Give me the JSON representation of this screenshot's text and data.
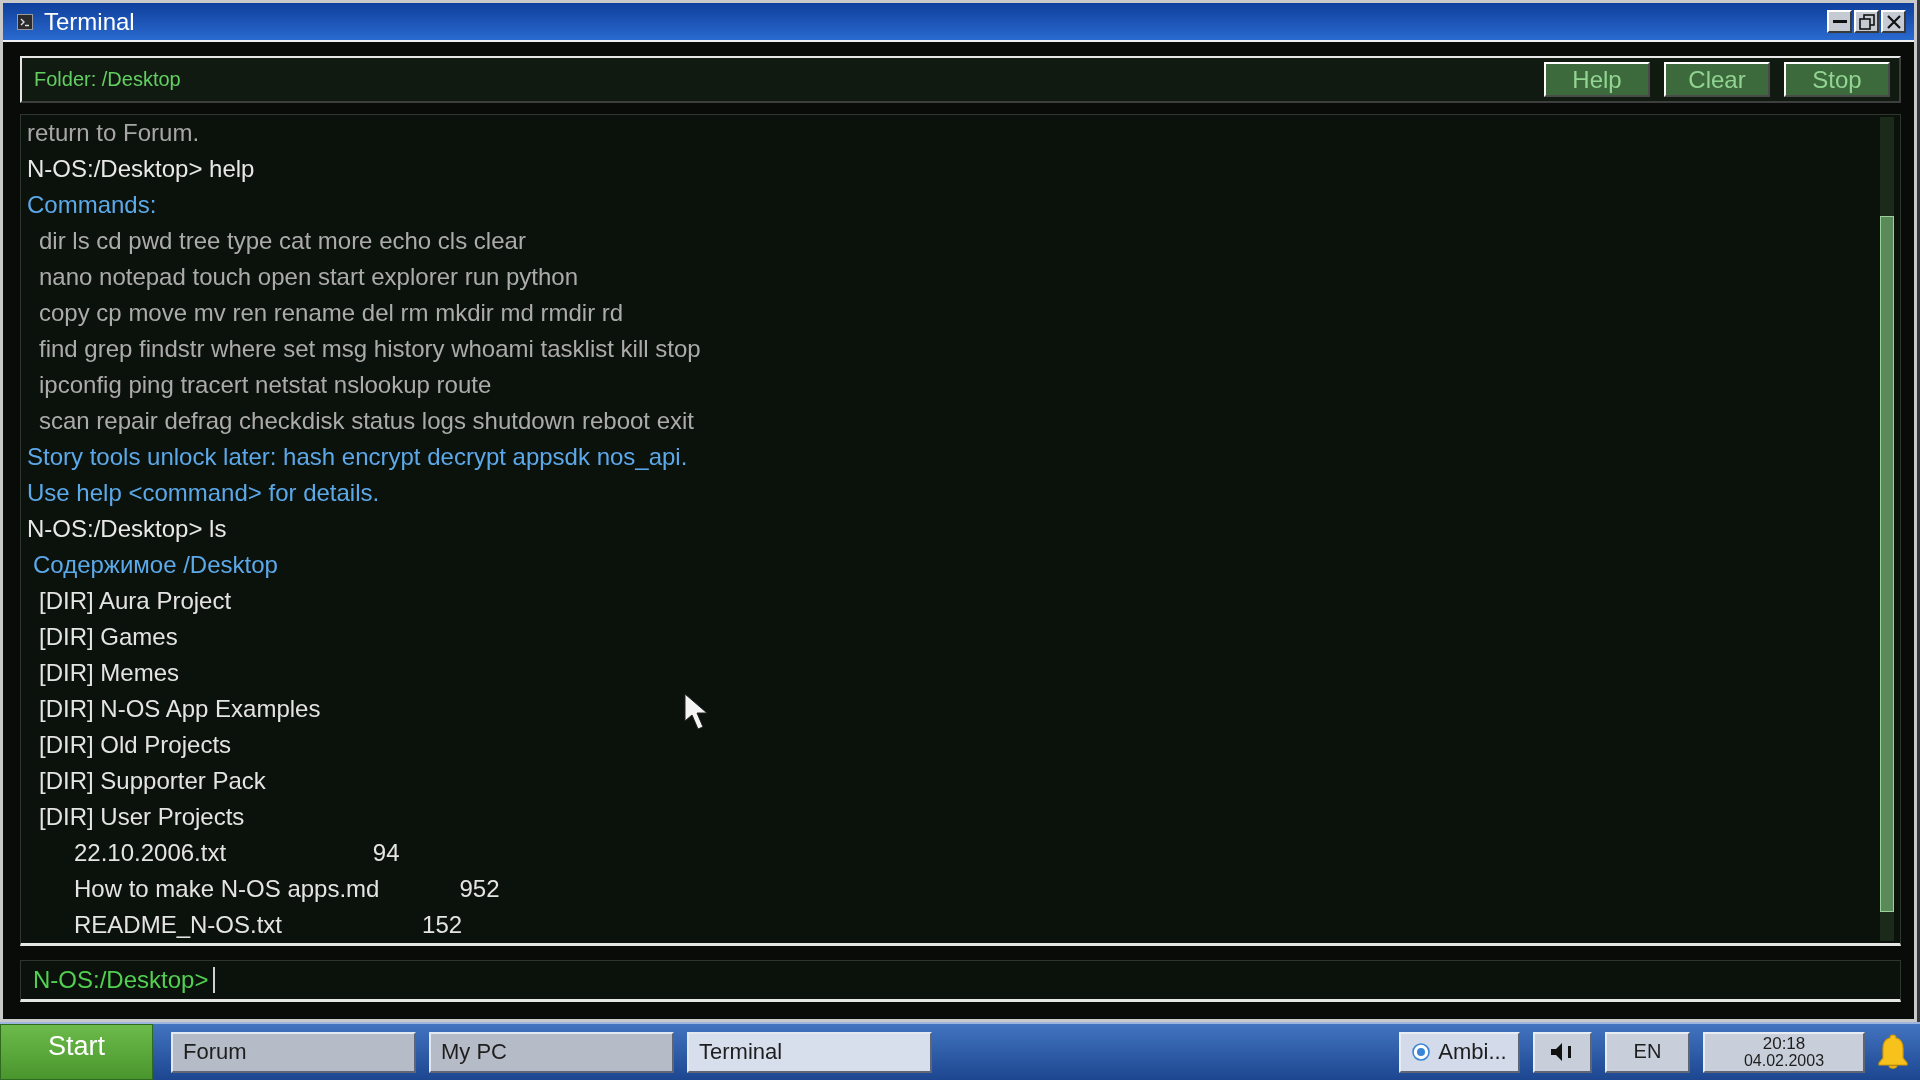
{
  "window": {
    "title": "Terminal"
  },
  "header": {
    "folder": "Folder: /Desktop",
    "buttons": [
      "Help",
      "Clear",
      "Stop"
    ]
  },
  "output": [
    {
      "kind": "muted",
      "text": "return to Forum."
    },
    {
      "kind": "prompt",
      "text": "N-OS:/Desktop> help"
    },
    {
      "kind": "info",
      "text": "Commands:"
    },
    {
      "kind": "list",
      "text": "dir ls cd pwd tree type cat more echo cls clear"
    },
    {
      "kind": "list",
      "text": "nano notepad touch open start explorer run python"
    },
    {
      "kind": "list",
      "text": "copy cp move mv ren rename del rm mkdir md rmdir rd"
    },
    {
      "kind": "list",
      "text": "find grep findstr where set msg history whoami tasklist kill stop"
    },
    {
      "kind": "list",
      "text": "ipconfig ping tracert netstat nslookup route"
    },
    {
      "kind": "list",
      "text": "scan repair defrag checkdisk status logs shutdown reboot exit"
    },
    {
      "kind": "info",
      "text": "Story tools unlock later: hash encrypt decrypt appsdk nos_api."
    },
    {
      "kind": "info",
      "text": "Use help <command> for details."
    },
    {
      "kind": "prompt",
      "text": "N-OS:/Desktop> ls"
    },
    {
      "kind": "heading",
      "text": "Содержимое /Desktop"
    },
    {
      "kind": "dir",
      "text": "[DIR] Aura Project"
    },
    {
      "kind": "dir",
      "text": "[DIR] Games"
    },
    {
      "kind": "dir",
      "text": "[DIR] Memes"
    },
    {
      "kind": "dir",
      "text": "[DIR] N-OS App Examples"
    },
    {
      "kind": "dir",
      "text": "[DIR] Old Projects"
    },
    {
      "kind": "dir",
      "text": "[DIR] Supporter Pack"
    },
    {
      "kind": "dir",
      "text": "[DIR] User Projects"
    },
    {
      "kind": "file",
      "name": "22.10.2006.txt",
      "size": "94"
    },
    {
      "kind": "file",
      "name": "How to make N-OS apps.md",
      "size": "952"
    },
    {
      "kind": "file",
      "name": "README_N-OS.txt",
      "size": "152"
    }
  ],
  "input": {
    "prompt": "N-OS:/Desktop>"
  },
  "taskbar": {
    "start": "Start",
    "tasks": [
      {
        "label": "Forum",
        "selected": false
      },
      {
        "label": "My PC",
        "selected": false
      },
      {
        "label": "Terminal",
        "selected": true
      }
    ],
    "tray": {
      "media": "Ambi...",
      "language": "EN",
      "time": "20:18",
      "date": "04.02.2003"
    }
  }
}
